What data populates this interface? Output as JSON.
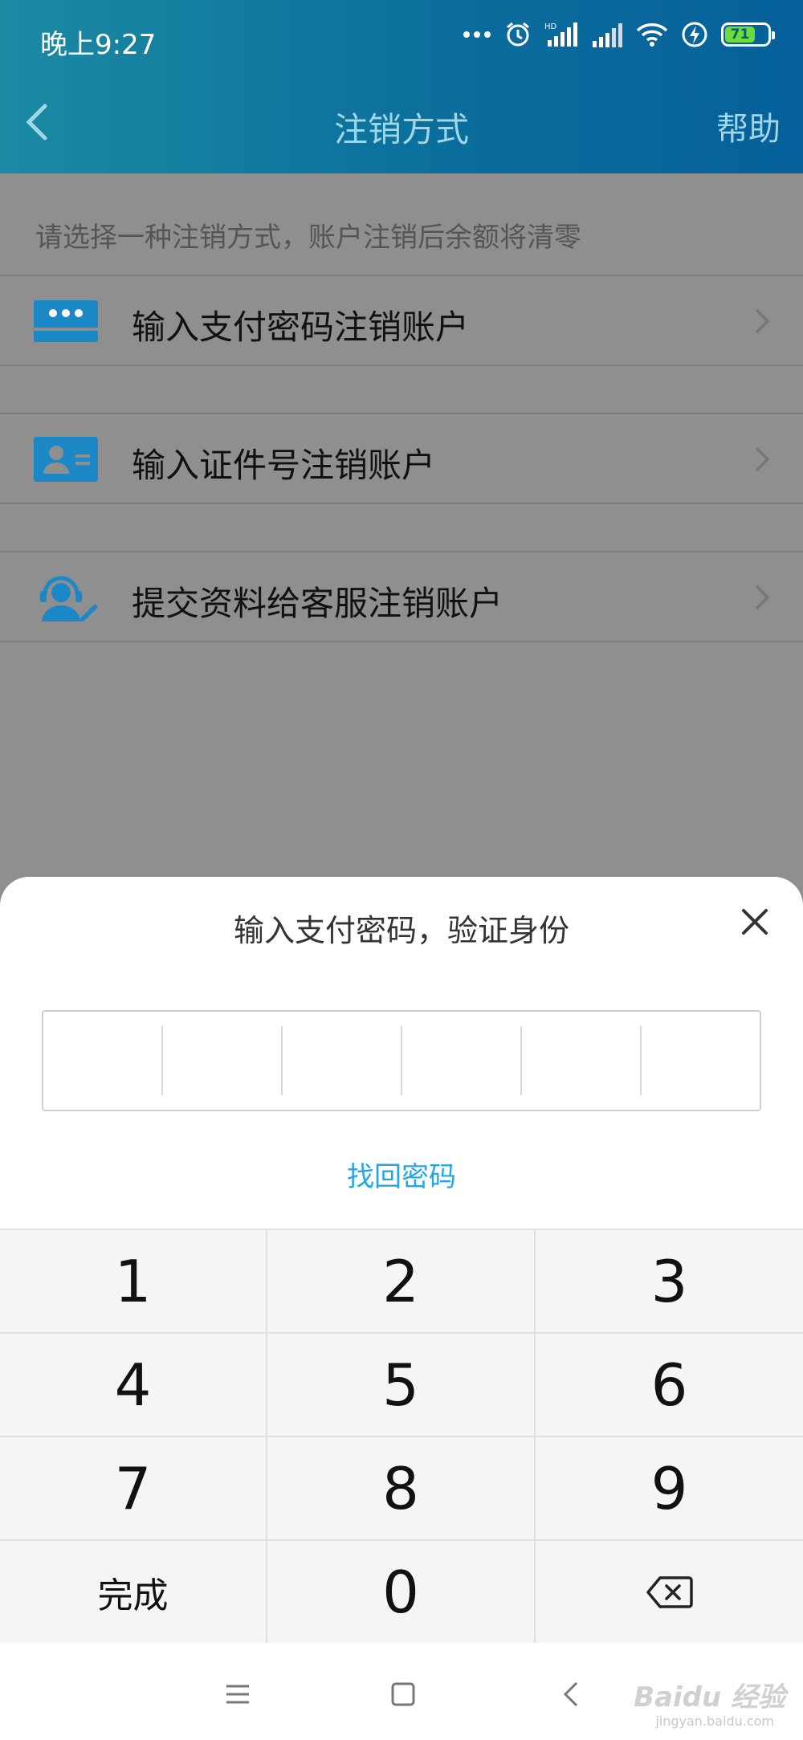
{
  "status_bar": {
    "time": "晚上9:27",
    "battery": "71",
    "network": "HD"
  },
  "nav": {
    "title": "注销方式",
    "help_label": "帮助"
  },
  "hint": "请选择一种注销方式，账户注销后余额将清零",
  "options": [
    {
      "label": "输入支付密码注销账户",
      "icon": "password-icon"
    },
    {
      "label": "输入证件号注销账户",
      "icon": "id-card-icon"
    },
    {
      "label": "提交资料给客服注销账户",
      "icon": "customer-service-icon"
    }
  ],
  "dialog": {
    "title": "输入支付密码，验证身份",
    "forgot_label": "找回密码"
  },
  "keypad": {
    "keys": [
      "1",
      "2",
      "3",
      "4",
      "5",
      "6",
      "7",
      "8",
      "9",
      "完成",
      "0"
    ],
    "backspace_icon": "backspace-icon"
  },
  "watermark": {
    "brand": "Baidu 经验",
    "url": "jingyan.baidu.com"
  },
  "colors": {
    "accent": "#22a7e6",
    "header": "#0b6e9c",
    "icon_blue": "#1d88c6"
  }
}
